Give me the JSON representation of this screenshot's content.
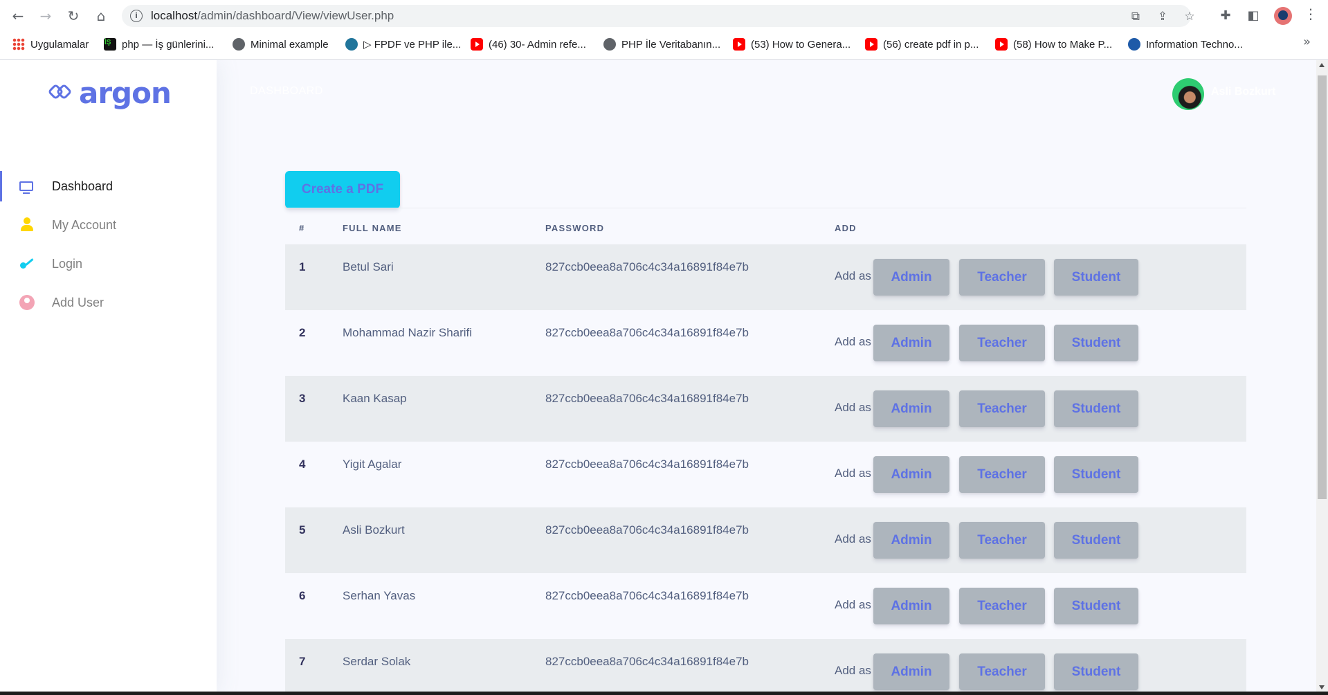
{
  "browser": {
    "url_host": "localhost",
    "url_path": "/admin/dashboard/View/viewUser.php",
    "bookmarks": [
      {
        "label": "Uygulamalar",
        "icon": "apps-icon"
      },
      {
        "label": "php — İş günlerini...",
        "icon": "php-favicon-icon"
      },
      {
        "label": "Minimal example",
        "icon": "globe-icon"
      },
      {
        "label": "▷ FPDF ve PHP ile...",
        "icon": "wordpress-icon"
      },
      {
        "label": "(46) 30- Admin refe...",
        "icon": "youtube-icon"
      },
      {
        "label": "PHP İle Veritabanın...",
        "icon": "globe-icon"
      },
      {
        "label": "(53) How to Genera...",
        "icon": "youtube-icon"
      },
      {
        "label": "(56) create pdf in p...",
        "icon": "youtube-icon"
      },
      {
        "label": "(58) How to Make P...",
        "icon": "youtube-icon"
      },
      {
        "label": "Information Techno...",
        "icon": "ge-icon"
      }
    ],
    "more_bookmarks": "»"
  },
  "brand": {
    "name": "argon",
    "color": "#5e72e4"
  },
  "sidebar": {
    "items": [
      {
        "label": "Dashboard",
        "icon": "tv-icon",
        "active": true
      },
      {
        "label": "My Account",
        "icon": "user-icon",
        "active": false
      },
      {
        "label": "Login",
        "icon": "key-icon",
        "active": false
      },
      {
        "label": "Add User",
        "icon": "user-circle-icon",
        "active": false
      }
    ]
  },
  "topbar": {
    "title": "DASHBOARD",
    "user_name": "Asli Bozkurt"
  },
  "pdf_button": {
    "label": "Create a PDF"
  },
  "table": {
    "headers": {
      "num": "#",
      "name": "FULL NAME",
      "password": "PASSWORD",
      "add": "ADD"
    },
    "add_as": "Add as",
    "buttons": {
      "admin": "Admin",
      "teacher": "Teacher",
      "student": "Student"
    },
    "rows": [
      {
        "num": "1",
        "name": "Betul Sari",
        "password": "827ccb0eea8a706c4c34a16891f84e7b"
      },
      {
        "num": "2",
        "name": "Mohammad Nazir Sharifi",
        "password": "827ccb0eea8a706c4c34a16891f84e7b"
      },
      {
        "num": "3",
        "name": "Kaan Kasap",
        "password": "827ccb0eea8a706c4c34a16891f84e7b"
      },
      {
        "num": "4",
        "name": "Yigit Agalar",
        "password": "827ccb0eea8a706c4c34a16891f84e7b"
      },
      {
        "num": "5",
        "name": "Asli Bozkurt",
        "password": "827ccb0eea8a706c4c34a16891f84e7b"
      },
      {
        "num": "6",
        "name": "Serhan Yavas",
        "password": "827ccb0eea8a706c4c34a16891f84e7b"
      },
      {
        "num": "7",
        "name": "Serdar Solak",
        "password": "827ccb0eea8a706c4c34a16891f84e7b"
      }
    ]
  },
  "colors": {
    "primary": "#5e72e4",
    "info": "#11cdef",
    "row_stripe": "#e9ecef",
    "role_button": "#adb5bd"
  }
}
